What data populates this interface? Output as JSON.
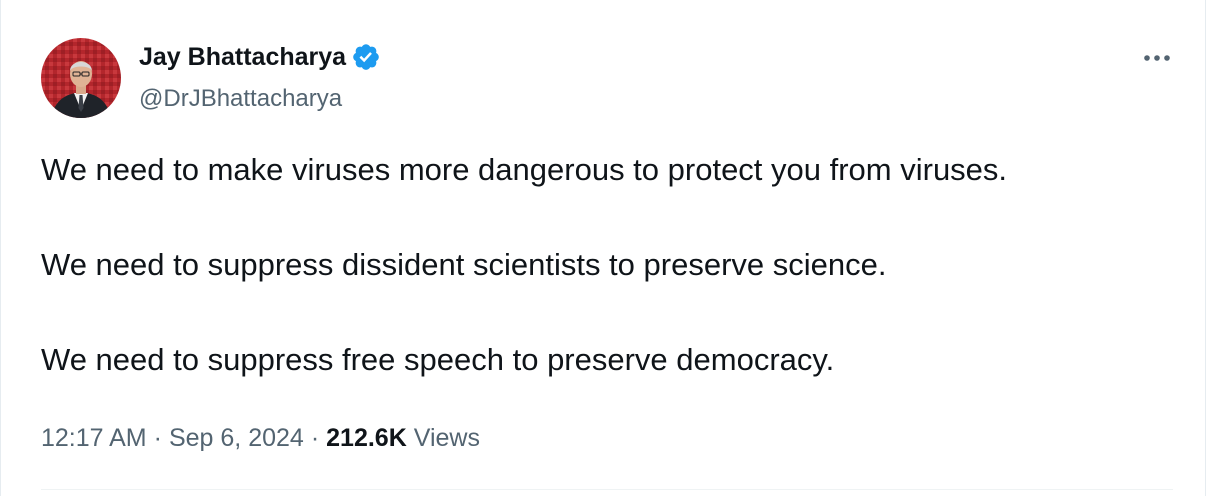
{
  "author": {
    "name": "Jay Bhattacharya",
    "handle": "@DrJBhattacharya",
    "verified_icon": "verified-badge-icon",
    "verified_color": "#1d9bf0"
  },
  "tweet": {
    "lines": [
      "We need to make viruses more dangerous to protect you from viruses.",
      "We need to suppress dissident scientists to preserve science.",
      "We need to suppress free speech to preserve democracy."
    ],
    "time": "12:17 AM",
    "separator": "·",
    "date": "Sep 6, 2024",
    "views_count": "212.6K",
    "views_label": "Views"
  },
  "menu": {
    "icon": "more-horizontal-icon"
  },
  "colors": {
    "text_primary": "#0f1419",
    "text_secondary": "#536471",
    "accent": "#1d9bf0"
  }
}
